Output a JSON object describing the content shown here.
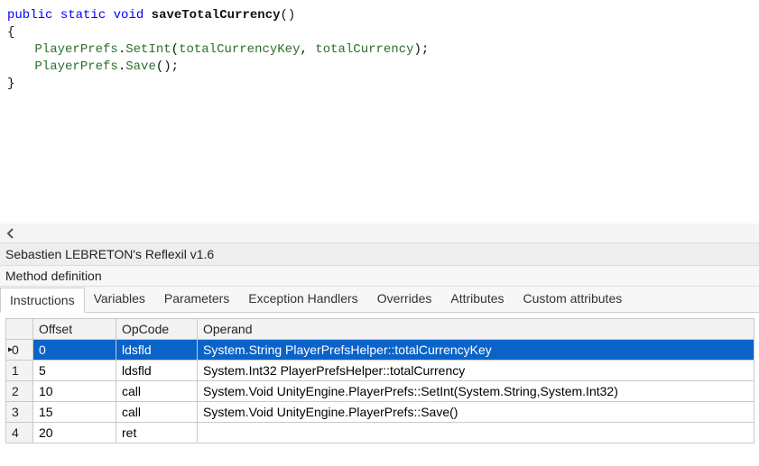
{
  "code": {
    "sig_kw1": "public",
    "sig_kw2": "static",
    "sig_kw3": "void",
    "sig_name": "saveTotalCurrency",
    "sig_parens": "()",
    "brace_open": "{",
    "line1_a": "PlayerPrefs",
    "line1_dot1": ".",
    "line1_b": "SetInt",
    "line1_paren_open": "(",
    "line1_arg1": "totalCurrencyKey",
    "line1_comma": ", ",
    "line1_arg2": "totalCurrency",
    "line1_paren_close": ");",
    "line2_a": "PlayerPrefs",
    "line2_dot1": ".",
    "line2_b": "Save",
    "line2_parens": "();",
    "brace_close": "}"
  },
  "panel": {
    "title": "Sebastien LEBRETON's Reflexil v1.6",
    "subtitle": "Method definition"
  },
  "tabs": {
    "t0": "Instructions",
    "t1": "Variables",
    "t2": "Parameters",
    "t3": "Exception Handlers",
    "t4": "Overrides",
    "t5": "Attributes",
    "t6": "Custom attributes"
  },
  "grid": {
    "headers": {
      "offset": "Offset",
      "opcode": "OpCode",
      "operand": "Operand"
    },
    "rows": [
      {
        "idx": "0",
        "offset": "0",
        "opcode": "ldsfld",
        "operand": "System.String PlayerPrefsHelper::totalCurrencyKey"
      },
      {
        "idx": "1",
        "offset": "5",
        "opcode": "ldsfld",
        "operand": "System.Int32 PlayerPrefsHelper::totalCurrency"
      },
      {
        "idx": "2",
        "offset": "10",
        "opcode": "call",
        "operand": "System.Void UnityEngine.PlayerPrefs::SetInt(System.String,System.Int32)"
      },
      {
        "idx": "3",
        "offset": "15",
        "opcode": "call",
        "operand": "System.Void UnityEngine.PlayerPrefs::Save()"
      },
      {
        "idx": "4",
        "offset": "20",
        "opcode": "ret",
        "operand": ""
      }
    ]
  }
}
